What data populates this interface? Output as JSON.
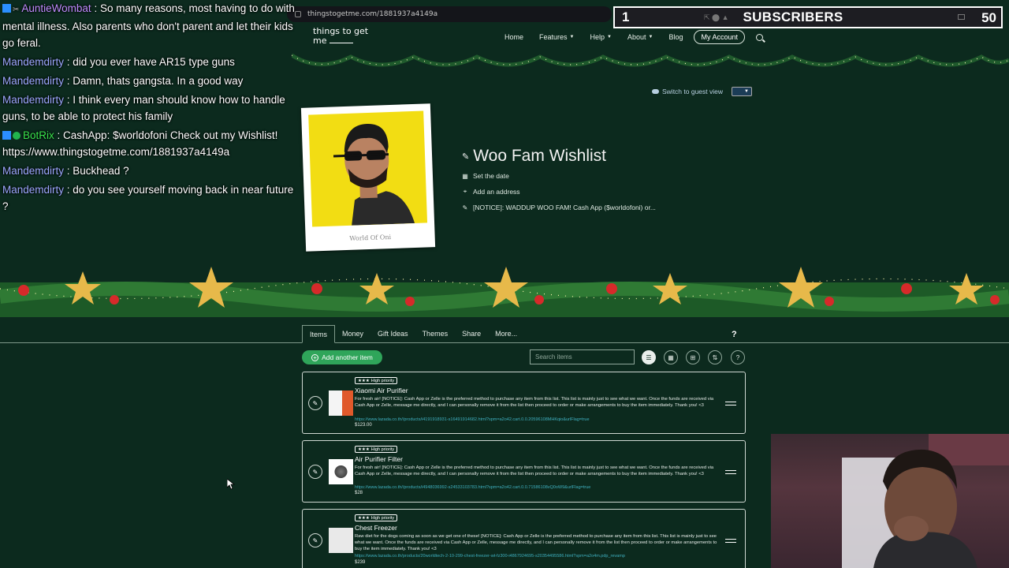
{
  "browser": {
    "url": "thingstogetme.com/1881937a4149a"
  },
  "site": {
    "logo_line1": "things to get",
    "logo_line2": "me",
    "nav": {
      "home": "Home",
      "features": "Features",
      "help": "Help",
      "about": "About",
      "blog": "Blog",
      "account": "My Account"
    },
    "guest_view": "Switch to guest view"
  },
  "profile": {
    "photo_caption": "World Of Oni",
    "title": "Woo Fam Wishlist",
    "set_date": "Set the date",
    "add_address": "Add an address",
    "notice": "[NOTICE]: WADDUP WOO FAM! Cash App ($worldofoni) or..."
  },
  "tabs": {
    "items": "Items",
    "money": "Money",
    "gift_ideas": "Gift Ideas",
    "themes": "Themes",
    "share": "Share",
    "more": "More..."
  },
  "toolbar": {
    "add_item": "Add another item",
    "search_placeholder": "Search items"
  },
  "items": [
    {
      "priority": "High priority",
      "name": "Xiaomi Air Purifier",
      "desc": "For fresh air! [NOTICE]: Cash App or Zelle is the preferred method to purchase any item from this list. This list is mainly just to see what we want. Once the funds are received via Cash App or Zelle, message me directly, and I can personally remove it from the list then proceed to order or make arrangements to buy the item immediately. Thank you! <3",
      "link": "https://www.lazada.co.th//products/i4191918931-s16491914682.html?spm=a2o42.cart.0.0.20596108MHKqio&urlFlag=true",
      "price": "$123.00"
    },
    {
      "priority": "High priority",
      "name": "Air Purifier Filter",
      "desc": "For fresh air! [NOTICE]: Cash App or Zelle is the preferred method to purchase any item from this list. This list is mainly just to see what we want. Once the funds are received via Cash App or Zelle, message me directly, and I can personally remove it from the list then proceed to order or make arrangements to buy the item immediately. Thank you! <3",
      "link": "https://www.lazada.co.th//products/i4948036992-s24533103783.html?spm=a2o42.cart.0.0.71586108vQ0oW9&urlFlag=true",
      "price": "$28"
    },
    {
      "priority": "High priority",
      "name": "Chest Freezer",
      "desc": "Raw diet for the dogs coming as soon as we get one of these! [NOTICE]: Cash App or Zelle is the preferred method to purchase any item from this list. This list is mainly just to see what we want. Once the funds are received via Cash App or Zelle, message me directly, and I can personally remove it from the list then proceed to order or make arrangements to buy the item immediately. Thank you! <3",
      "link": "https://www.lazada.co.th/products/20worldtech-2-10-299-chest-freezer-wt-fz300-i4867924695-s20354495586.html?spm=a2o4m.pdp_revamp",
      "price": "$239"
    }
  ],
  "chat": [
    {
      "user": "AuntieWombat",
      "text": ": So many reasons, most having to do with mental illness. Also parents who don't parent and let their kids go feral."
    },
    {
      "user": "Mandemdirty",
      "text": ": did you ever have AR15 type guns"
    },
    {
      "user": "Mandemdirty",
      "text": ": Damn, thats gangsta. In a good way"
    },
    {
      "user": "Mandemdirty",
      "text": ": I think every man should know how to handle guns, to be able to protect his family"
    },
    {
      "user": "BotRix",
      "text": ": CashApp: $worldofoni Check out my Wishlist! https://www.thingstogetme.com/1881937a4149a"
    },
    {
      "user": "Mandemdirty",
      "text": ": Buckhead ?"
    },
    {
      "user": "Mandemdirty",
      "text": ": do you see yourself moving back in near future ?"
    }
  ],
  "subs_overlay": {
    "count": "1",
    "label": "SUBSCRIBERS",
    "goal": "50"
  }
}
